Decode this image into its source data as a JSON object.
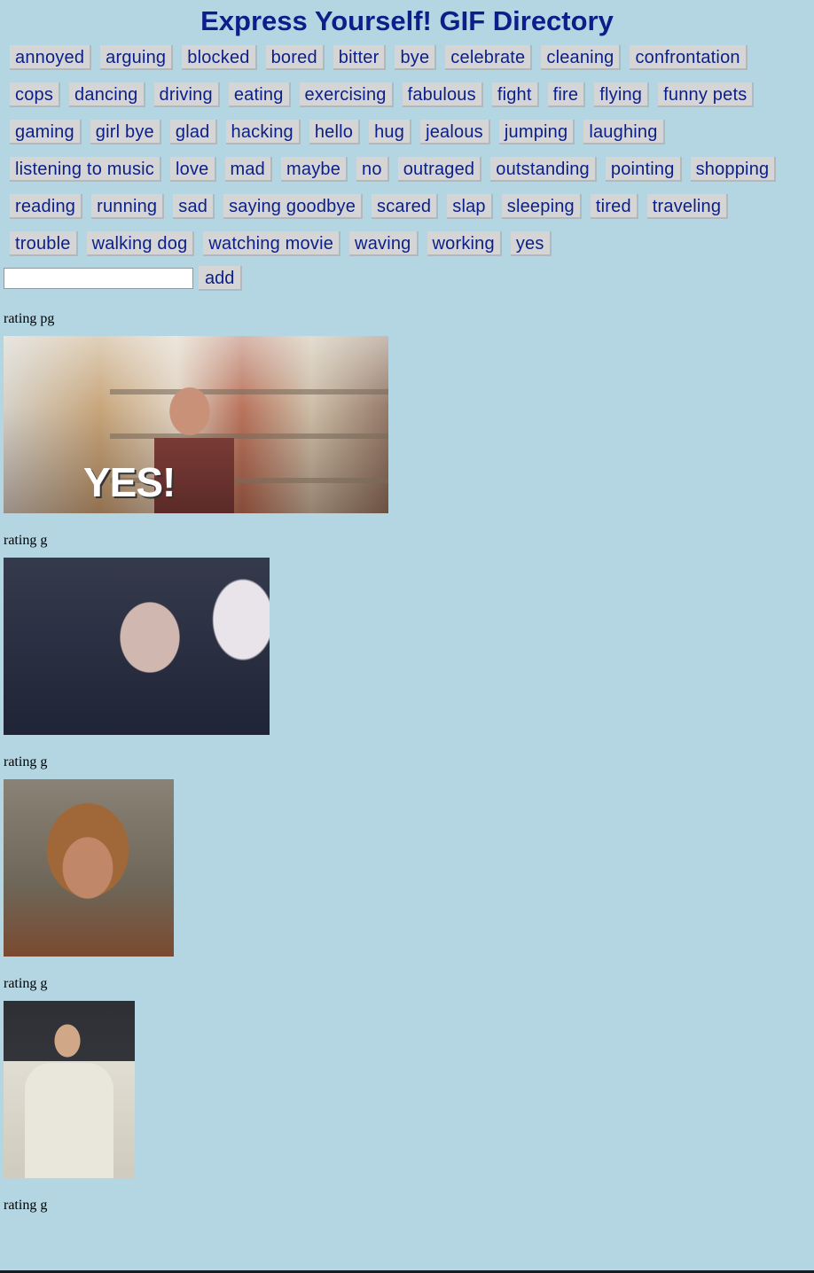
{
  "header": {
    "title": "Express Yourself! GIF Directory"
  },
  "tags": [
    "annoyed",
    "arguing",
    "blocked",
    "bored",
    "bitter",
    "bye",
    "celebrate",
    "cleaning",
    "confrontation",
    "cops",
    "dancing",
    "driving",
    "eating",
    "exercising",
    "fabulous",
    "fight",
    "fire",
    "flying",
    "funny pets",
    "gaming",
    "girl bye",
    "glad",
    "hacking",
    "hello",
    "hug",
    "jealous",
    "jumping",
    "laughing",
    "listening to music",
    "love",
    "mad",
    "maybe",
    "no",
    "outraged",
    "outstanding",
    "pointing",
    "shopping",
    "reading",
    "running",
    "sad",
    "saying goodbye",
    "scared",
    "slap",
    "sleeping",
    "tired",
    "traveling",
    "trouble",
    "walking dog",
    "watching movie",
    "waving",
    "working",
    "yes"
  ],
  "add_form": {
    "input_value": "",
    "placeholder": "",
    "button_label": "add"
  },
  "results": [
    {
      "rating": "rating pg",
      "overlay_text": "YES!"
    },
    {
      "rating": "rating g"
    },
    {
      "rating": "rating g"
    },
    {
      "rating": "rating g"
    },
    {
      "rating": "rating g"
    }
  ],
  "colors": {
    "background": "#b4d6e2",
    "accent": "#0a1f8a",
    "button_bg": "#d5d5d5"
  }
}
